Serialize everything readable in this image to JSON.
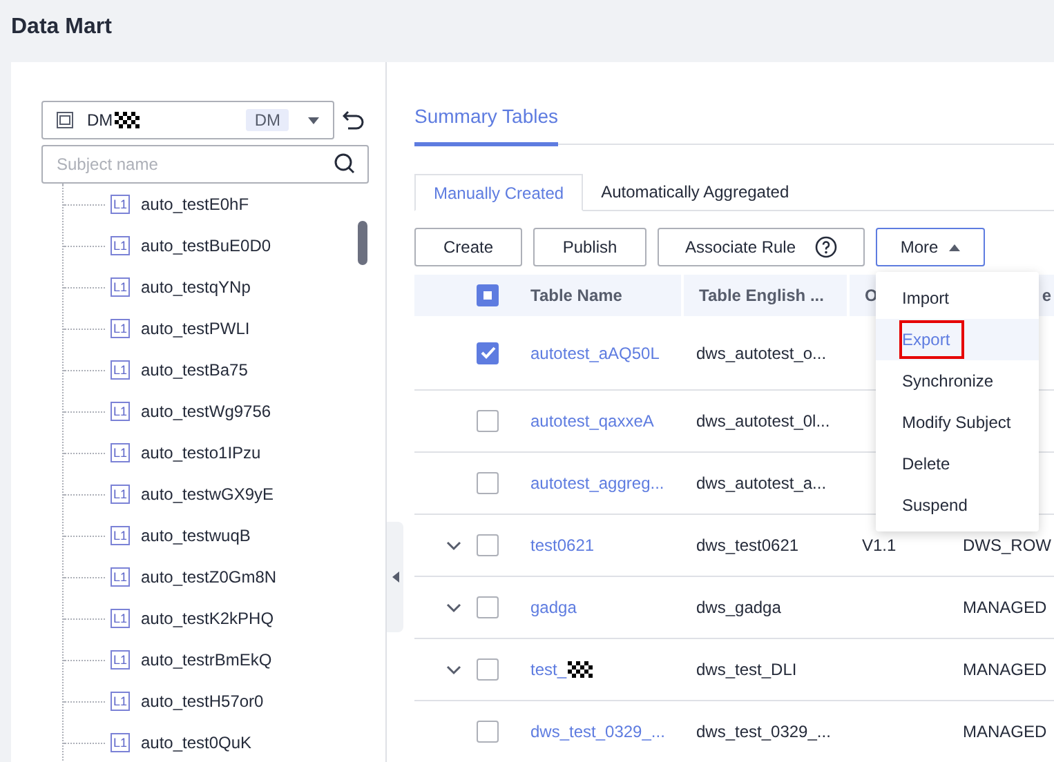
{
  "page_title": "Data Mart",
  "workspace_select": {
    "value": "DM",
    "badge": "DM"
  },
  "search": {
    "placeholder": "Subject name"
  },
  "tree_items": [
    {
      "label": "auto_testE0hF",
      "badge": "L1"
    },
    {
      "label": "auto_testBuE0D0",
      "badge": "L1"
    },
    {
      "label": "auto_testqYNp",
      "badge": "L1"
    },
    {
      "label": "auto_testPWLI",
      "badge": "L1"
    },
    {
      "label": "auto_testBa75",
      "badge": "L1"
    },
    {
      "label": "auto_testWg9756",
      "badge": "L1"
    },
    {
      "label": "auto_testo1IPzu",
      "badge": "L1"
    },
    {
      "label": "auto_testwGX9yE",
      "badge": "L1"
    },
    {
      "label": "auto_testwuqB",
      "badge": "L1"
    },
    {
      "label": "auto_testZ0Gm8N",
      "badge": "L1"
    },
    {
      "label": "auto_testK2kPHQ",
      "badge": "L1"
    },
    {
      "label": "auto_testrBmEkQ",
      "badge": "L1"
    },
    {
      "label": "auto_testH57or0",
      "badge": "L1"
    },
    {
      "label": "auto_test0QuK",
      "badge": "L1"
    }
  ],
  "page_tab": {
    "label": "Summary Tables",
    "selected": true
  },
  "tabs": [
    {
      "label": "Manually Created",
      "selected": true
    },
    {
      "label": "Automatically Aggregated",
      "selected": false
    }
  ],
  "toolbar": [
    {
      "label": "Create",
      "kind": "plain"
    },
    {
      "label": "Publish",
      "kind": "plain"
    },
    {
      "label": "Associate Rule",
      "kind": "help"
    },
    {
      "label": "More",
      "kind": "menu"
    }
  ],
  "table": {
    "select_all_indeterminate": true,
    "columns": [
      "Table Name",
      "Table English ...",
      "O",
      "e"
    ],
    "rows": [
      {
        "expandable": false,
        "checked": true,
        "name": "autotest_aAQ50L",
        "english": "dws_autotest_o...",
        "version": "",
        "type": "",
        "redacted": false
      },
      {
        "expandable": false,
        "checked": false,
        "name": "autotest_qaxxeA",
        "english": "dws_autotest_0l...",
        "version": "",
        "type": "",
        "redacted": false
      },
      {
        "expandable": false,
        "checked": false,
        "name": "autotest_aggreg...",
        "english": "dws_autotest_a...",
        "version": "",
        "type": "",
        "redacted": false
      },
      {
        "expandable": true,
        "checked": false,
        "name": "test0621",
        "english": "dws_test0621",
        "version": "V1.1",
        "type": "DWS_ROW",
        "redacted": false
      },
      {
        "expandable": true,
        "checked": false,
        "name": "gadga",
        "english": "dws_gadga",
        "version": "",
        "type": "MANAGED",
        "redacted": false
      },
      {
        "expandable": true,
        "checked": false,
        "name": "test_",
        "english": "dws_test_DLI",
        "version": "",
        "type": "MANAGED",
        "redacted": true
      },
      {
        "expandable": false,
        "checked": false,
        "name": "dws_test_0329_...",
        "english": "dws_test_0329_...",
        "version": "",
        "type": "MANAGED",
        "redacted": false
      }
    ]
  },
  "more_menu": [
    {
      "label": "Import",
      "selected": false
    },
    {
      "label": "Export",
      "selected": true
    },
    {
      "label": "Synchronize",
      "selected": false
    },
    {
      "label": "Modify Subject",
      "selected": false
    },
    {
      "label": "Delete",
      "selected": false
    },
    {
      "label": "Suspend",
      "selected": false
    }
  ]
}
